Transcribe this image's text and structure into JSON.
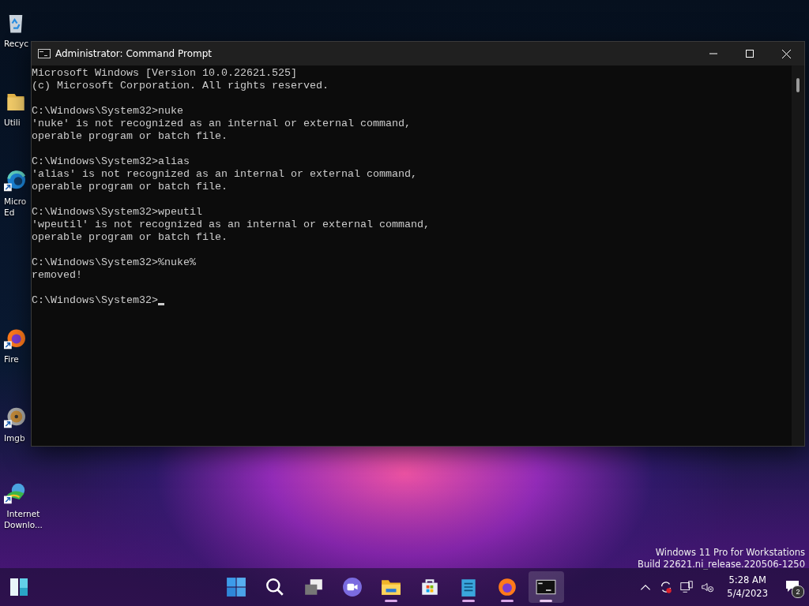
{
  "desktop_icons": [
    {
      "kind": "recycle-bin",
      "lines": [
        "Recyc"
      ],
      "shortcut": false
    },
    {
      "kind": "folder",
      "lines": [
        "Utili"
      ],
      "shortcut": false
    },
    {
      "kind": "edge",
      "lines": [
        "Micro",
        "Ed"
      ],
      "shortcut": true
    },
    {
      "kind": "firefox",
      "lines": [
        "Fire"
      ],
      "shortcut": true
    },
    {
      "kind": "disc",
      "lines": [
        "Imgb"
      ],
      "shortcut": true
    },
    {
      "kind": "download-globe",
      "lines": [
        "Internet",
        "Downlo..."
      ],
      "shortcut": true
    }
  ],
  "window": {
    "title": "Administrator: Command Prompt",
    "cursor": true,
    "blocks": [
      [
        "Microsoft Windows [Version 10.0.22621.525]",
        "(c) Microsoft Corporation. All rights reserved."
      ],
      [
        "C:\\Windows\\System32>nuke",
        "'nuke' is not recognized as an internal or external command,",
        "operable program or batch file."
      ],
      [
        "C:\\Windows\\System32>alias",
        "'alias' is not recognized as an internal or external command,",
        "operable program or batch file."
      ],
      [
        "C:\\Windows\\System32>wpeutil",
        "'wpeutil' is not recognized as an internal or external command,",
        "operable program or batch file."
      ],
      [
        "C:\\Windows\\System32>%nuke%",
        "removed!"
      ],
      [
        "C:\\Windows\\System32>"
      ]
    ]
  },
  "edition_notice": [
    "Windows 11 Pro for Workstations",
    "Build 22621.ni_release.220506-1250"
  ],
  "taskbar": {
    "items": [
      {
        "kind": "start",
        "running": false,
        "selected": false
      },
      {
        "kind": "search",
        "running": false,
        "selected": false
      },
      {
        "kind": "task-view",
        "running": false,
        "selected": false
      },
      {
        "kind": "chat",
        "running": false,
        "selected": false
      },
      {
        "kind": "explorer",
        "running": true,
        "selected": false
      },
      {
        "kind": "store",
        "running": false,
        "selected": false
      },
      {
        "kind": "notepad",
        "running": true,
        "selected": false
      },
      {
        "kind": "firefox",
        "running": true,
        "selected": false
      },
      {
        "kind": "terminal",
        "running": true,
        "selected": true
      }
    ],
    "tray": {
      "time": "5:28 AM",
      "date": "5/4/2023",
      "notifications": "2"
    }
  }
}
